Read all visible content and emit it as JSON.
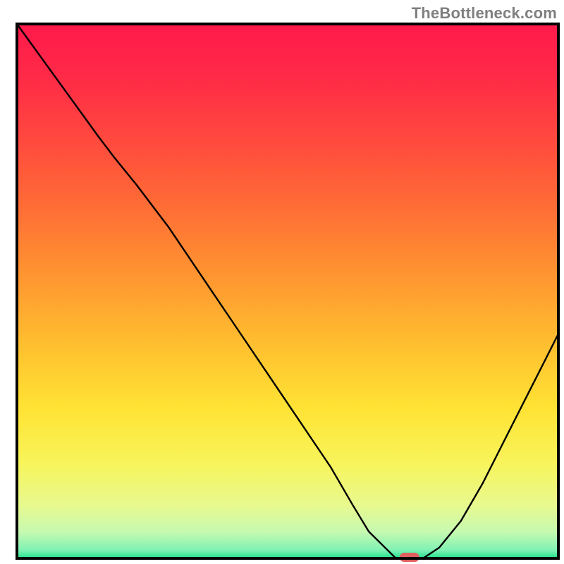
{
  "attribution": "TheBottleneck.com",
  "chart_data": {
    "type": "line",
    "title": "",
    "xlabel": "",
    "ylabel": "",
    "xlim": [
      0,
      100
    ],
    "ylim": [
      0,
      100
    ],
    "series": [
      {
        "name": "curve",
        "x": [
          0,
          5,
          10,
          15,
          18,
          22,
          28,
          34,
          40,
          46,
          52,
          58,
          62,
          65,
          68,
          70,
          72,
          75,
          78,
          82,
          86,
          90,
          94,
          97,
          100
        ],
        "y": [
          100,
          93,
          86,
          79,
          75,
          70,
          62,
          53,
          44,
          35,
          26,
          17,
          10,
          5,
          2,
          0,
          0,
          0,
          2,
          7,
          14,
          22,
          30,
          36,
          42
        ]
      }
    ],
    "marker": {
      "x": 72.5,
      "y": 0,
      "color": "#e0605f"
    },
    "gradient_bands": [
      {
        "stop": 0.0,
        "color": "#ff1a4b"
      },
      {
        "stop": 0.1,
        "color": "#ff2a47"
      },
      {
        "stop": 0.22,
        "color": "#ff4a3e"
      },
      {
        "stop": 0.35,
        "color": "#ff6f35"
      },
      {
        "stop": 0.48,
        "color": "#ff9830"
      },
      {
        "stop": 0.6,
        "color": "#ffbf2f"
      },
      {
        "stop": 0.72,
        "color": "#ffe334"
      },
      {
        "stop": 0.82,
        "color": "#f8f45a"
      },
      {
        "stop": 0.9,
        "color": "#e8f98e"
      },
      {
        "stop": 0.95,
        "color": "#c7f9b0"
      },
      {
        "stop": 0.985,
        "color": "#7ef2b4"
      },
      {
        "stop": 1.0,
        "color": "#1de18a"
      }
    ],
    "frame_color": "#000000",
    "curve_color": "#000000"
  }
}
